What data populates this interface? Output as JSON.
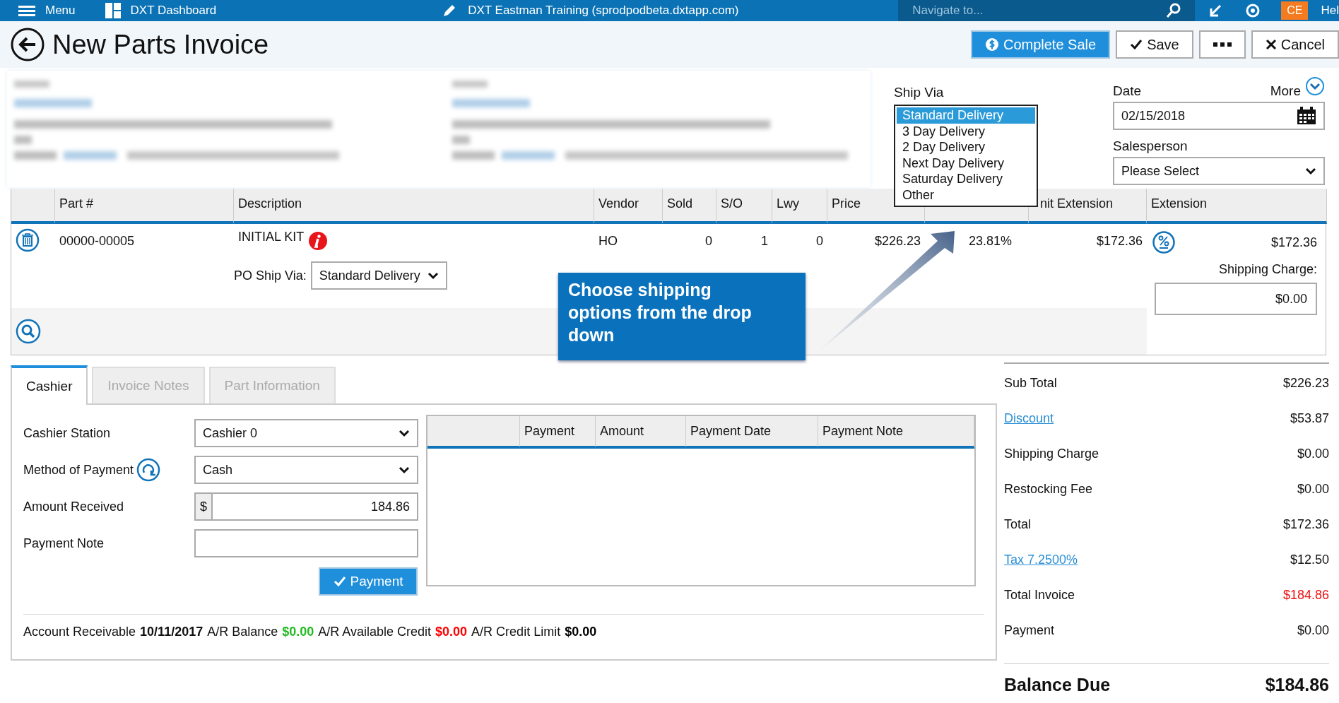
{
  "top_bar": {
    "menu_label": "Menu",
    "dashboard_label": "DXT Dashboard",
    "environment": "DXT Eastman Training (sprodpodbeta.dxtapp.com)",
    "search": {
      "placeholder": "Navigate to..."
    },
    "user_initials": "CE",
    "help_label": "Hel"
  },
  "header": {
    "title": "New Parts Invoice",
    "buttons": [
      {
        "kind": "complete",
        "label": "Complete Sale"
      },
      {
        "kind": "save",
        "label": "Save"
      },
      {
        "kind": "more"
      },
      {
        "kind": "cancel",
        "label": "Cancel"
      }
    ]
  },
  "ship_via": {
    "label": "Ship Via",
    "options": [
      {
        "label": "Standard Delivery",
        "selected": true
      },
      {
        "label": "3 Day Delivery",
        "selected": false
      },
      {
        "label": "2 Day Delivery",
        "selected": false
      },
      {
        "label": "Next Day Delivery",
        "selected": false
      },
      {
        "label": "Saturday Delivery",
        "selected": false
      },
      {
        "label": "Other",
        "selected": false
      }
    ]
  },
  "more_label": "More",
  "date": {
    "label": "Date",
    "value": "02/15/2018"
  },
  "salesperson": {
    "label": "Salesperson",
    "value": "Please Select"
  },
  "line_items": {
    "columns": [
      {
        "kind": "text",
        "label": "Part #"
      },
      {
        "kind": "text",
        "label": "Description"
      },
      {
        "kind": "text",
        "label": "Vendor"
      },
      {
        "kind": "text",
        "label": "Sold"
      },
      {
        "kind": "text",
        "label": "S/O"
      },
      {
        "kind": "text",
        "label": "Lwy"
      },
      {
        "kind": "text",
        "label": "Price"
      },
      {
        "kind": "covered"
      },
      {
        "kind": "text",
        "label": "nit Extension"
      },
      {
        "kind": "text",
        "label": "Extension"
      }
    ],
    "rows": [
      {
        "part": "00000-00005",
        "description": "INITIAL KIT",
        "vendor": "HO",
        "sold": "0",
        "so": "1",
        "lwy": "0",
        "price": "$226.23",
        "column_8": "23.81%",
        "unit_extension": "$172.36",
        "extension": "$172.36",
        "po_ship_via_label": "PO Ship Via:",
        "po_ship_via": "Standard Delivery",
        "shipping_charge_label": "Shipping Charge:",
        "shipping_charge": "$0.00"
      }
    ]
  },
  "callout": {
    "text": "Choose shipping options from the drop down"
  },
  "tabs": [
    {
      "label": "Cashier",
      "selected": true
    },
    {
      "label": "Invoice Notes",
      "selected": false
    },
    {
      "label": "Part Information",
      "selected": false
    }
  ],
  "cashier": {
    "fields": [
      {
        "kind": "select",
        "label": "Cashier Station",
        "value": "Cashier 0"
      },
      {
        "kind": "select_refresh",
        "label": "Method of Payment",
        "value": "Cash"
      },
      {
        "kind": "currency",
        "label": "Amount Received",
        "prefix": "$",
        "value": "184.86"
      },
      {
        "kind": "text",
        "label": "Payment Note"
      }
    ],
    "payment_button": "Payment",
    "payments_table": {
      "columns": [
        "Payment",
        "Amount",
        "Payment Date",
        "Payment Note"
      ]
    },
    "account": {
      "label": "Account Receivable",
      "date": "10/11/2017",
      "items": [
        {
          "label": "A/R Balance",
          "value": "$0.00",
          "color": "#22bb22"
        },
        {
          "label": "A/R Available Credit",
          "value": "$0.00",
          "color": "#ff0000"
        },
        {
          "label": "A/R Credit Limit",
          "value": "$0.00",
          "color": "#000000"
        }
      ]
    }
  },
  "summary": {
    "rows": [
      {
        "kind": "plain",
        "label": "Sub Total",
        "value": "$226.23"
      },
      {
        "kind": "link",
        "label": "Discount",
        "value": "$53.87"
      },
      {
        "kind": "plain",
        "label": "Shipping Charge",
        "value": "$0.00"
      },
      {
        "kind": "plain",
        "label": "Restocking Fee",
        "value": "$0.00"
      },
      {
        "kind": "plain",
        "label": "Total",
        "value": "$172.36"
      },
      {
        "kind": "link",
        "label": "Tax 7.2500%",
        "value": "$12.50"
      },
      {
        "kind": "alert",
        "label": "Total Invoice",
        "value": "$184.86"
      },
      {
        "kind": "plain",
        "label": "Payment",
        "value": "$0.00"
      }
    ],
    "balance": {
      "label": "Balance Due",
      "value": "$184.86"
    }
  }
}
